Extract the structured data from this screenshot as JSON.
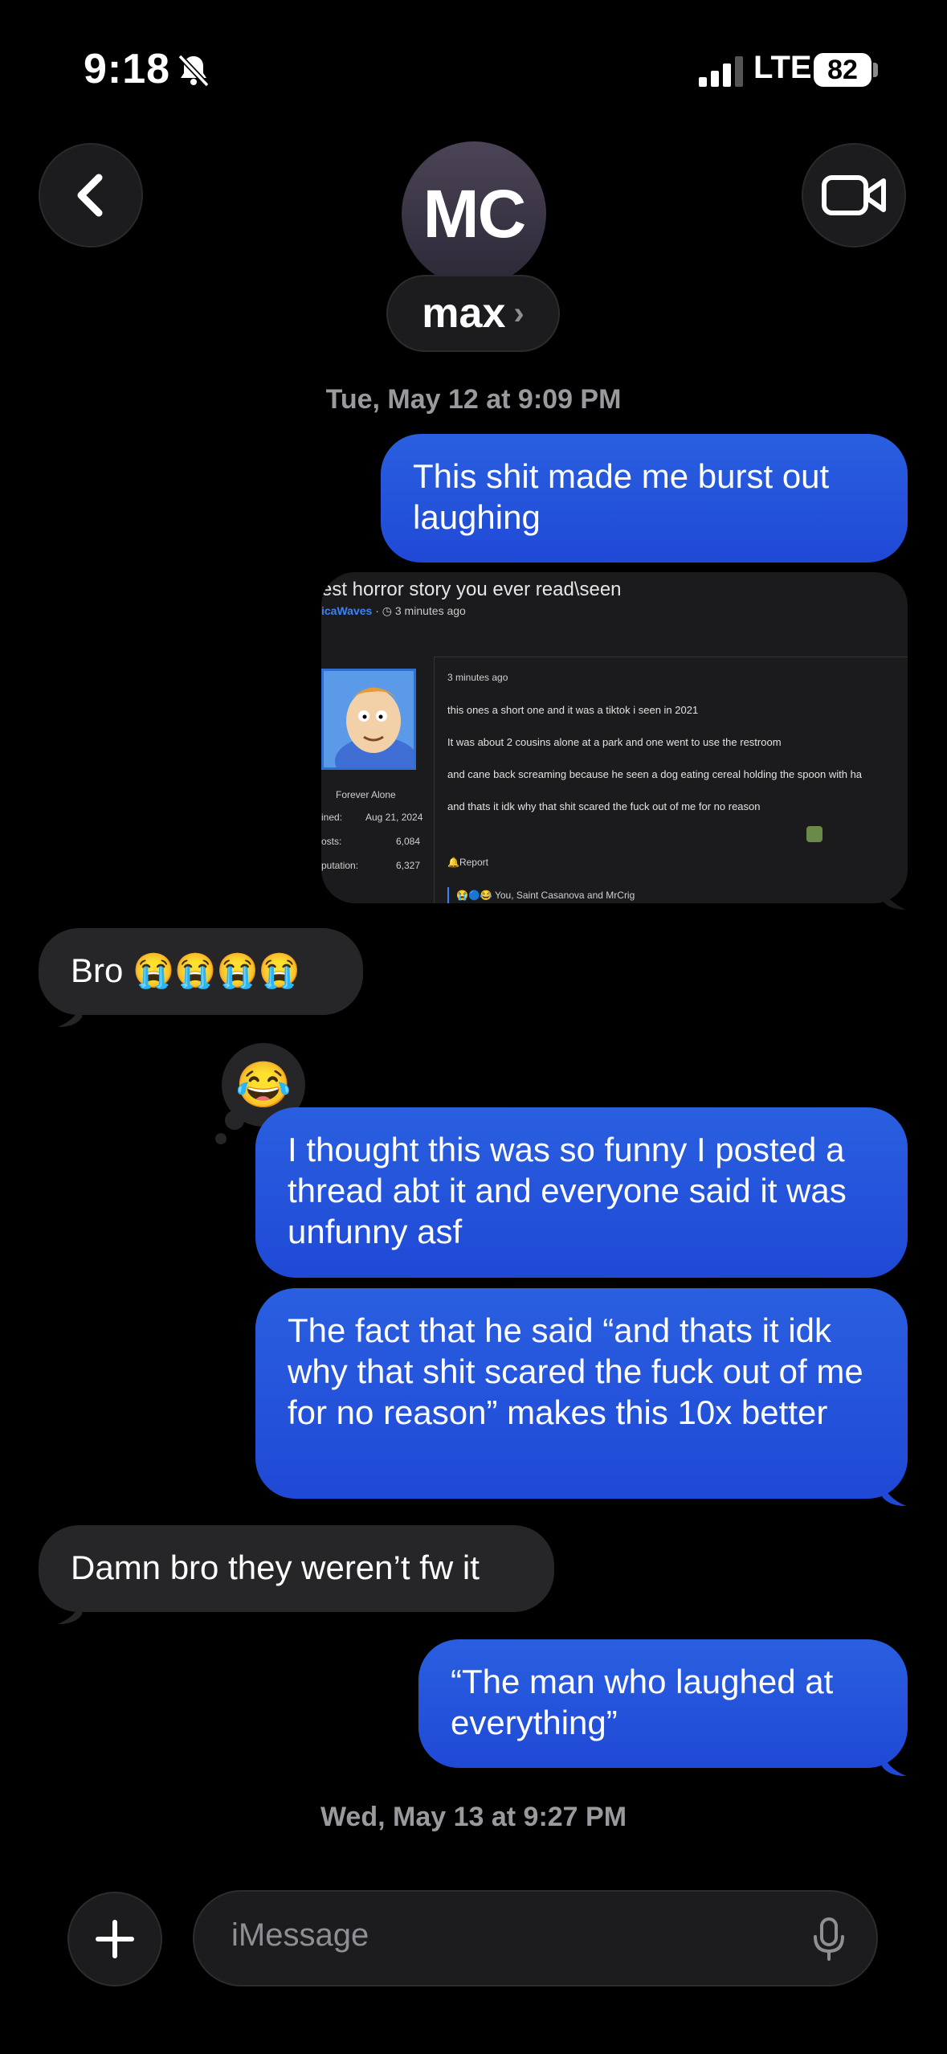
{
  "status_bar": {
    "time": "9:18",
    "network": "LTE",
    "battery": "82"
  },
  "header": {
    "avatar_initials": "MC",
    "contact_name": "max",
    "name_chevron": "›"
  },
  "timestamps": [
    "Tue, May 12 at 9:09 PM",
    "Wed, May 13 at 9:27 PM"
  ],
  "messages": [
    {
      "from": "me",
      "text": "This shit made me burst out laughing"
    },
    {
      "from": "me",
      "type": "image",
      "alt": "forum screenshot"
    },
    {
      "from": "them",
      "text": "Bro 😭😭😭😭"
    },
    {
      "from": "me",
      "text": "I thought this was so funny I posted a thread abt it and everyone said it was unfunny asf",
      "reaction": "😂"
    },
    {
      "from": "me",
      "text": "The fact that he said “and thats it idk why that shit scared the fuck out of me for no reason” makes this 10x better"
    },
    {
      "from": "them",
      "text": "Damn bro they weren’t fw it"
    },
    {
      "from": "me",
      "text": "“The man who laughed at everything”"
    }
  ],
  "attachment": {
    "title": "est horror story you ever read\\seen",
    "author": "icaWaves",
    "meta_time": "3 minutes ago",
    "post_time": "3 minutes ago",
    "user_title": "Forever Alone",
    "stats": [
      {
        "label": "ined:",
        "value": "Aug 21, 2024"
      },
      {
        "label": "osts:",
        "value": "6,084"
      },
      {
        "label": "putation:",
        "value": "6,327"
      }
    ],
    "post_lines": [
      "this ones a short one and it was a tiktok i seen in 2021",
      "It was about 2 cousins alone at a park and one went to use the restroom",
      "and cane back screaming because he seen a dog eating cereal holding the spoon with ha",
      "and thats it idk why that shit scared the fuck out of me for no reason"
    ],
    "report_label": "Report",
    "reactions_label": "You, Saint Casanova and MrCrig"
  },
  "composer": {
    "placeholder": "iMessage"
  },
  "colors": {
    "sent_bubble": "#2150db",
    "received_bubble": "#262628",
    "background": "#000000"
  }
}
